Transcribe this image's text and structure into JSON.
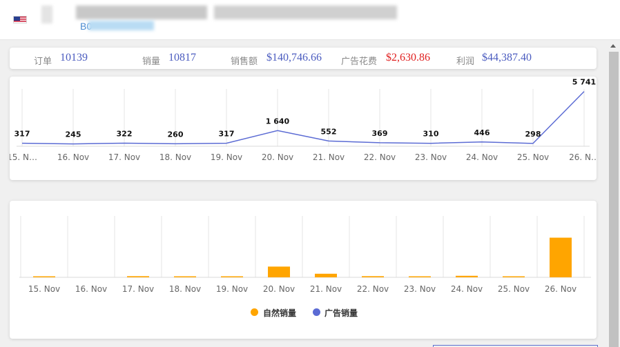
{
  "header": {
    "asin_prefix": "B0"
  },
  "stats": [
    {
      "label": "订单",
      "value": "10139"
    },
    {
      "label": "销量",
      "value": "10817"
    },
    {
      "label": "销售额",
      "value": "$140,746.66"
    },
    {
      "label": "广告花费",
      "value": "$2,630.86"
    },
    {
      "label": "利润",
      "value": "$44,387.40"
    }
  ],
  "colors": {
    "line": "#5b6bd4",
    "organic": "#ffa500",
    "ads": "#5b6bd4",
    "ad_spend": "#e02020"
  },
  "chart_data": [
    {
      "type": "line",
      "categories": [
        "15. Nov",
        "16. Nov",
        "17. Nov",
        "18. Nov",
        "19. Nov",
        "20. Nov",
        "21. Nov",
        "22. Nov",
        "23. Nov",
        "24. Nov",
        "25. Nov",
        "26. Nov"
      ],
      "tick_labels": [
        "15. N…",
        "16. Nov",
        "17. Nov",
        "18. Nov",
        "19. Nov",
        "20. Nov",
        "21. Nov",
        "22. Nov",
        "23. Nov",
        "24. Nov",
        "25. Nov",
        "26. N…"
      ],
      "values": [
        317,
        245,
        322,
        260,
        317,
        1640,
        552,
        369,
        310,
        446,
        298,
        5741
      ],
      "data_labels": [
        "317",
        "245",
        "322",
        "260",
        "317",
        "1 640",
        "552",
        "369",
        "310",
        "446",
        "298",
        "5 741"
      ],
      "ylim": [
        0,
        6000
      ],
      "grid": "vertical"
    },
    {
      "type": "bar",
      "categories": [
        "15. Nov",
        "16. Nov",
        "17. Nov",
        "18. Nov",
        "19. Nov",
        "20. Nov",
        "21. Nov",
        "22. Nov",
        "23. Nov",
        "24. Nov",
        "25. Nov",
        "26. Nov"
      ],
      "series": [
        {
          "name": "自然销量",
          "values": [
            20,
            0,
            45,
            15,
            30,
            420,
            140,
            45,
            25,
            60,
            40,
            1550
          ]
        },
        {
          "name": "广告销量",
          "values": [
            0,
            0,
            0,
            0,
            0,
            0,
            0,
            0,
            0,
            0,
            0,
            0
          ]
        }
      ],
      "ylim": [
        0,
        2400
      ],
      "grid": "vertical",
      "legend": "bottom-center"
    }
  ]
}
